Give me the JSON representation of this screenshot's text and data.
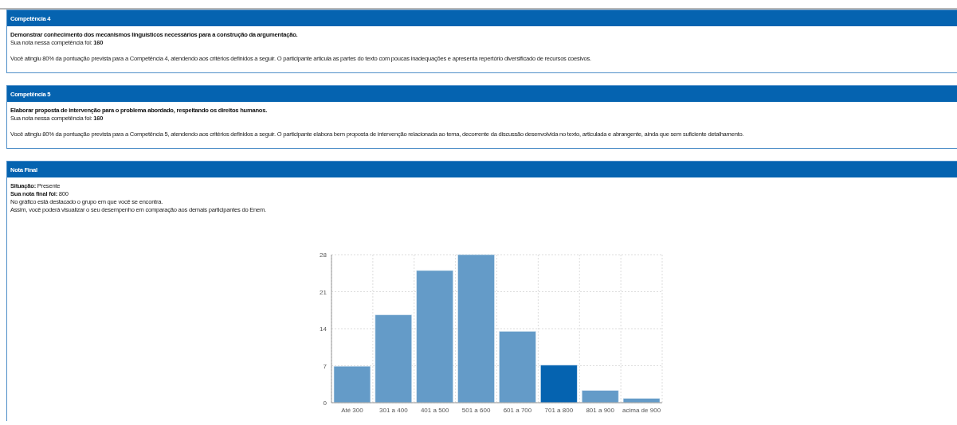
{
  "competencias": [
    {
      "title": "Competência 4",
      "description": "Demonstrar conhecimento dos mecanismos linguísticos necessários para a construção da argumentação.",
      "score_line": "Sua nota nessa competência foi: **160**",
      "feedback": "Você atingiu 80% da pontuação prevista para a Competência 4, atendendo aos critérios definidos a seguir. O participante articula as partes do texto com poucas inadequações e apresenta repertório diversificado de recursos coesivos."
    },
    {
      "title": "Competência 5",
      "description": "Elaborar proposta de intervenção para o problema abordado, respeitando os direitos humanos.",
      "score_line": "Sua nota nessa competência foi: **160**",
      "feedback": "Você atingiu 80% da pontuação prevista para a Competência 5, atendendo aos critérios definidos a seguir. O participante elabora bem proposta de intervenção relacionada ao tema, decorrente da discussão desenvolvida no texto, articulada e abrangente, ainda que sem suficiente detalhamento."
    }
  ],
  "nota_final": {
    "title": "Nota Final",
    "lines": [
      "**Situação:** Presente",
      "**Sua nota final foi:** 800",
      "No gráfico está destacado o grupo em que você se encontra.",
      "Assim, você poderá visualizar o seu desempenho em comparação aos demais participantes do Enem."
    ],
    "chart_data": {
      "type": "bar",
      "categories": [
        "Até 300",
        "301 a 400",
        "401 a 500",
        "501 a 600",
        "601 a 700",
        "701 a 800",
        "801 a 900",
        "acima de 900"
      ],
      "series": [
        {
          "color": "#649bc8",
          "values": [
            6.9,
            16.6,
            25.0,
            28.0,
            13.5,
            null,
            2.3,
            0.8
          ]
        },
        {
          "color": "#0563b0",
          "values": [
            null,
            null,
            null,
            null,
            null,
            7.1,
            null,
            null
          ]
        }
      ],
      "grid": true,
      "ylim": [
        0,
        28
      ],
      "yticks": [
        0,
        7,
        14,
        21,
        28
      ]
    }
  }
}
